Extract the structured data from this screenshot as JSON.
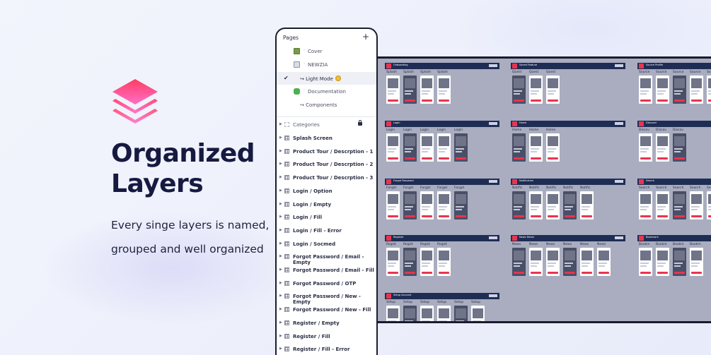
{
  "hero": {
    "headline_line1": "Organized",
    "headline_line2": "Layers",
    "subtext_line1": "Every singe layers is named,",
    "subtext_line2": "grouped and well organized"
  },
  "colors": {
    "accent": "#e8354f",
    "logo_gradient_top": "#ff4a6e",
    "logo_gradient_bottom": "#ff6fc3",
    "ink": "#161a40"
  },
  "layers_panel": {
    "pages_title": "Pages",
    "pages": [
      {
        "label": "Cover",
        "icon": "image-icon",
        "prefix": "·"
      },
      {
        "label": "NEWZIA",
        "icon": "frame-icon",
        "prefix": "·"
      },
      {
        "label": "↪ Light Mode",
        "icon": "",
        "selected": true
      },
      {
        "label": "Documentation",
        "icon": "puzzle-icon",
        "prefix": "·"
      },
      {
        "label": "↪ Components",
        "icon": ""
      }
    ],
    "categories_label": "Categories",
    "layers": [
      "Splash Screen",
      "Product Tour / Descrption - 1",
      "Product Tour / Descrption - 2",
      "Product Tour / Descrption - 3",
      "Login / Option",
      "Login / Empty",
      "Login / Fill",
      "Login / Fill - Error",
      "Login / Socmed",
      "Forgot Password / Email - Empty",
      "Forgot Password / Email - Fill",
      "Forgot Password / OTP",
      "Forgot Password / New - Empty",
      "Forgot Password / New - Fill",
      "Register / Empty",
      "Register / Fill",
      "Register / Fill - Error"
    ]
  },
  "canvas": {
    "sections": [
      {
        "title": "Onboarding",
        "frame_label": "Splash",
        "count": 4
      },
      {
        "title": "Saved Feature",
        "frame_label": "Quest",
        "count": 3
      },
      {
        "title": "Source Profile",
        "frame_label": "Source",
        "count": 5
      },
      {
        "title": "Login",
        "frame_label": "Login",
        "count": 5
      },
      {
        "title": "Home",
        "frame_label": "Home",
        "count": 3
      },
      {
        "title": "Discover",
        "frame_label": "Discov",
        "count": 3
      },
      {
        "title": "Forgot Password",
        "frame_label": "Forgot",
        "count": 5
      },
      {
        "title": "Notification",
        "frame_label": "Notific",
        "count": 5
      },
      {
        "title": "Search",
        "frame_label": "Search",
        "count": 5
      },
      {
        "title": "Register",
        "frame_label": "Regist",
        "count": 4
      },
      {
        "title": "News Detail",
        "frame_label": "News",
        "count": 6
      },
      {
        "title": "Bookmark",
        "frame_label": "Bookm",
        "count": 4
      },
      {
        "title": "Setup Account",
        "frame_label": "Setup",
        "count": 6
      }
    ]
  }
}
